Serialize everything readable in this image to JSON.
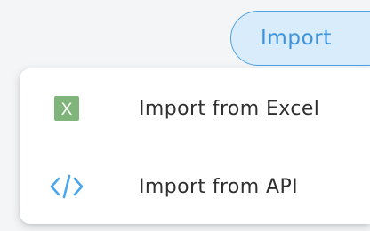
{
  "import_button": {
    "label": "Import"
  },
  "menu": {
    "items": [
      {
        "label": "Import from Excel",
        "icon": "excel-icon",
        "icon_letter": "X"
      },
      {
        "label": "Import from API",
        "icon": "code-icon"
      }
    ]
  },
  "colors": {
    "accent": "#3d93db",
    "button_bg": "#d9ecfb",
    "excel_green": "#7fb57a",
    "code_blue": "#4aa6ef",
    "text": "#2f2f2f"
  }
}
